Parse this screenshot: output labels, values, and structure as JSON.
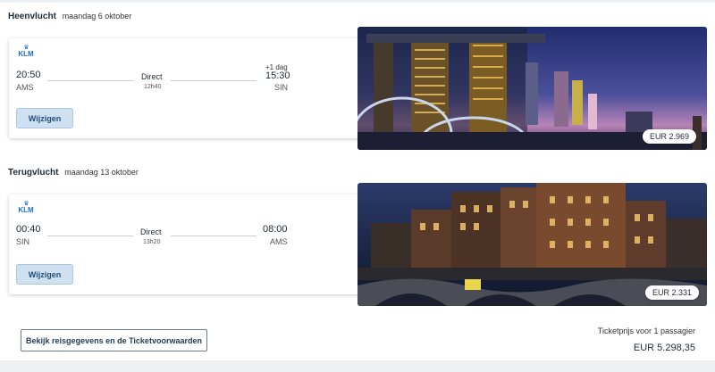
{
  "outbound": {
    "label": "Heenvlucht",
    "date": "maandag 6 oktober",
    "airline_logo": "KLM",
    "airline_icon": "klm-crown-icon",
    "dep_time": "20:50",
    "dep_code": "AMS",
    "type": "Direct",
    "duration": "12h40",
    "plus_day": "+1 dag",
    "arr_time": "15:30",
    "arr_code": "SIN",
    "change_label": "Wijzigen",
    "price": "EUR 2.969"
  },
  "return": {
    "label": "Terugvlucht",
    "date": "maandag 13 oktober",
    "airline_logo": "KLM",
    "airline_icon": "klm-crown-icon",
    "dep_time": "00:40",
    "dep_code": "SIN",
    "type": "Direct",
    "duration": "13h20",
    "arr_time": "08:00",
    "arr_code": "AMS",
    "change_label": "Wijzigen",
    "price": "EUR 2.331"
  },
  "footer": {
    "terms_label": "Bekijk reisgegevens en de Ticketvoorwaarden",
    "ticket_price_label": "Ticketprijs voor 1 passagier",
    "total": "EUR 5.298,35"
  },
  "colors": {
    "brand_blue": "#1b6fd8",
    "button_bg": "#cfe1f1",
    "text": "#1f2a37"
  }
}
